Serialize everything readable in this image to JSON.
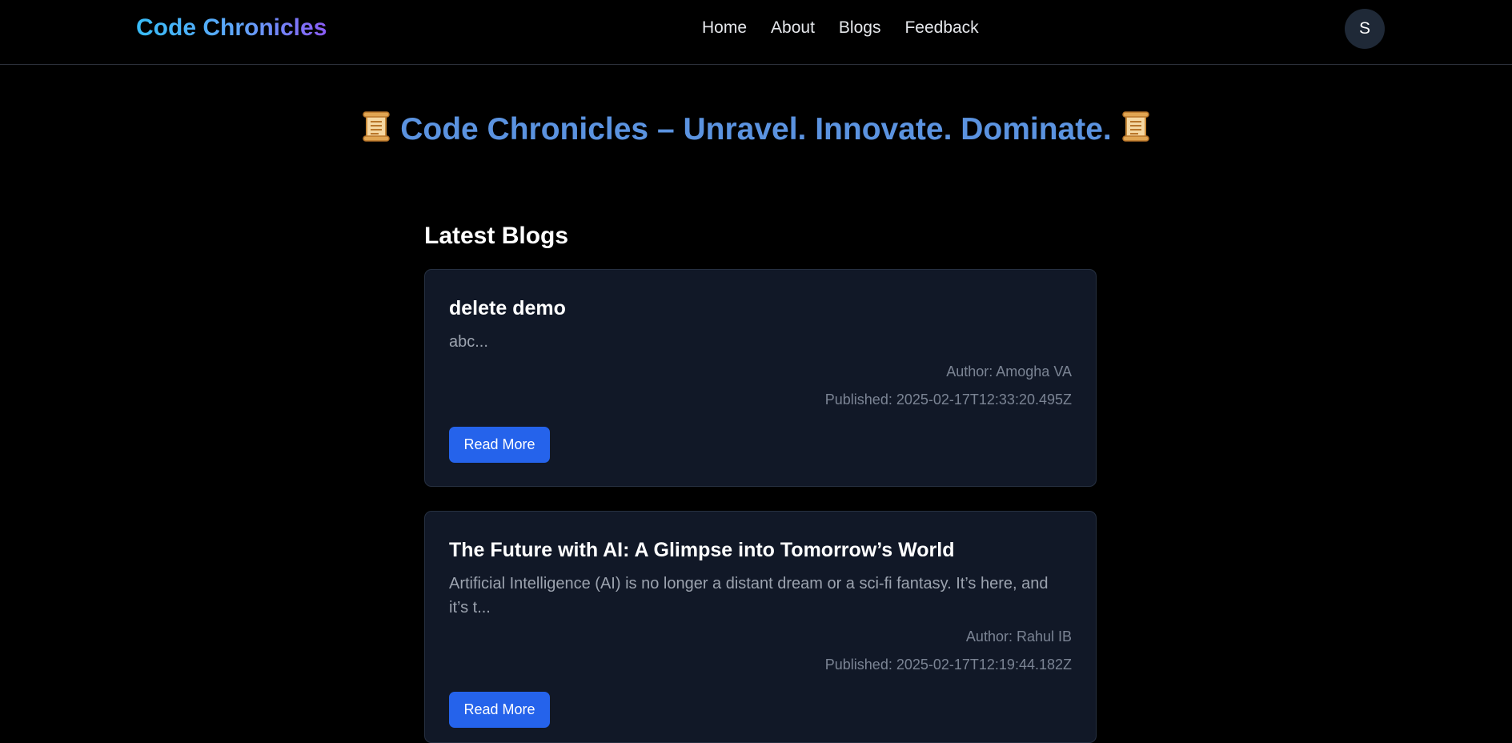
{
  "header": {
    "brand": "Code Chronicles",
    "nav": [
      "Home",
      "About",
      "Blogs",
      "Feedback"
    ],
    "avatar_initial": "S"
  },
  "hero": {
    "title": "Code Chronicles – Unravel. Innovate. Dominate.",
    "icon": "scroll-icon"
  },
  "blogs": {
    "section_title": "Latest Blogs",
    "posts": [
      {
        "title": "delete demo",
        "excerpt": "abc...",
        "author": "Author: Amogha VA",
        "published": "Published: 2025-02-17T12:33:20.495Z",
        "button": "Read More"
      },
      {
        "title": "The Future with AI: A Glimpse into Tomorrow’s World",
        "excerpt": "Artificial Intelligence (AI) is no longer a distant dream or a sci-fi fantasy. It’s here, and it’s t...",
        "author": "Author: Rahul IB",
        "published": "Published: 2025-02-17T12:19:44.182Z",
        "button": "Read More"
      }
    ]
  },
  "colors": {
    "background": "#000000",
    "card": "#111827",
    "accent": "#2563eb",
    "hero_text": "#5b93e0"
  }
}
